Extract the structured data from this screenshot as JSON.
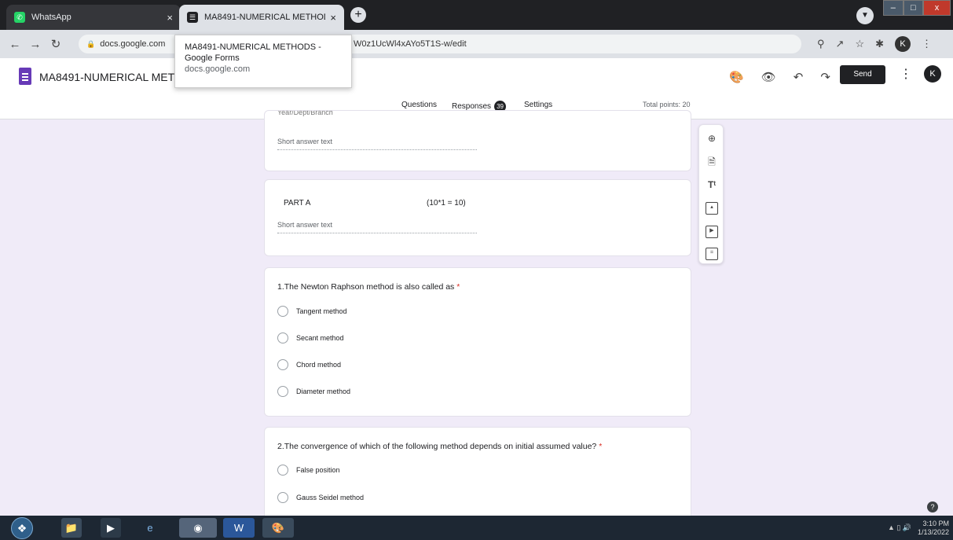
{
  "browser": {
    "tabs": [
      {
        "title": "WhatsApp",
        "icon": "whatsapp-icon"
      },
      {
        "title": "MA8491-NUMERICAL METHODS",
        "icon": "forms-icon"
      }
    ],
    "address": {
      "host": "docs.google.com",
      "path_tail": "W0z1UcWl4xAYo5T1S-w/edit"
    },
    "tooltip": {
      "title": "MA8491-NUMERICAL METHODS - Google Forms",
      "host": "docs.google.com"
    },
    "profile_initial": "K"
  },
  "form_header": {
    "title": "MA8491-NUMERICAL METH",
    "send_label": "Send",
    "avatar_initial": "K",
    "tabs": {
      "questions": "Questions",
      "responses": "Responses",
      "responses_count": "39",
      "settings": "Settings"
    },
    "total_points": "Total points: 20"
  },
  "cards": {
    "card1": {
      "cut_label": "Year/Dept/Branch",
      "placeholder": "Short answer text"
    },
    "card2": {
      "title": "PART A",
      "marks": "(10*1 = 10)",
      "placeholder": "Short answer text"
    },
    "q1": {
      "title": "1.The Newton Raphson method is also called as",
      "required": "*",
      "options": [
        "Tangent method",
        "Secant method",
        "Chord method",
        "Diameter method"
      ]
    },
    "q2": {
      "title": "2.The convergence of which of the following method depends on initial assumed value?",
      "required": "*",
      "options": [
        "False position",
        "Gauss Seidel method"
      ]
    }
  },
  "taskbar": {
    "time": "3:10 PM",
    "date": "1/13/2022"
  }
}
